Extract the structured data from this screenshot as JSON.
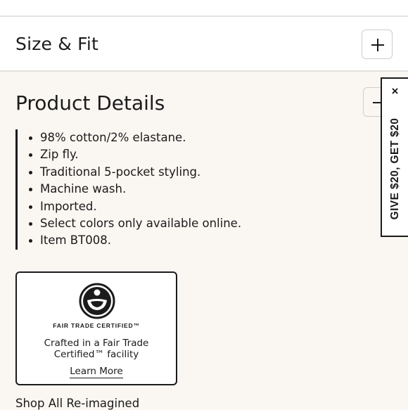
{
  "size_fit": {
    "title": "Size & Fit"
  },
  "product_details": {
    "title": "Product Details",
    "bullets": [
      "98% cotton/2% elastane.",
      "Zip fly.",
      "Traditional 5-pocket styling.",
      "Machine wash.",
      "Imported.",
      "Select colors only available online.",
      "Item BT008."
    ]
  },
  "fair_trade": {
    "label": "FAIR TRADE CERTIFIED™",
    "text_line1": "Crafted in a Fair Trade",
    "text_line2": "Certified™ facility",
    "link": "Learn More",
    "icon": "fair-trade-logo"
  },
  "shop_all": "Shop All Re-imagined",
  "promo": {
    "close": "×",
    "text": "GIVE $20, GET $20"
  },
  "colors": {
    "background": "#faf6f2",
    "text": "#1b1b1b",
    "border": "#e4e1dd"
  }
}
